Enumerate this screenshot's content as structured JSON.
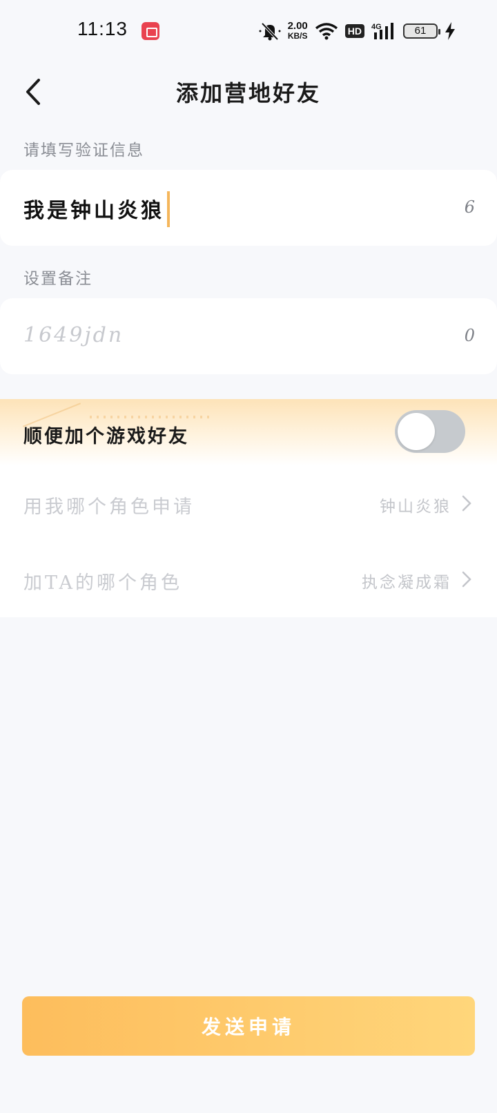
{
  "status_bar": {
    "time": "11:13",
    "net_speed": "2.00",
    "net_speed_unit": "KB/S",
    "hd_label": "HD",
    "network_type": "4G",
    "battery": "61"
  },
  "header": {
    "title": "添加营地好友"
  },
  "verification": {
    "label": "请填写验证信息",
    "value": "我是钟山炎狼",
    "count": "6"
  },
  "remark": {
    "label": "设置备注",
    "placeholder": "1649jdn",
    "count": "0"
  },
  "game_friend": {
    "toggle_label": "顺便加个游戏好友",
    "toggle_on": false,
    "my_role_label": "用我哪个角色申请",
    "my_role_value": "钟山炎狼",
    "their_role_label": "加TA的哪个角色",
    "their_role_value": "执念凝成霜"
  },
  "submit": {
    "label": "发送申请"
  },
  "colors": {
    "accent": "#f5b65b",
    "button_start": "#fdbd5c",
    "button_end": "#ffd67b",
    "background": "#f7f8fb"
  }
}
